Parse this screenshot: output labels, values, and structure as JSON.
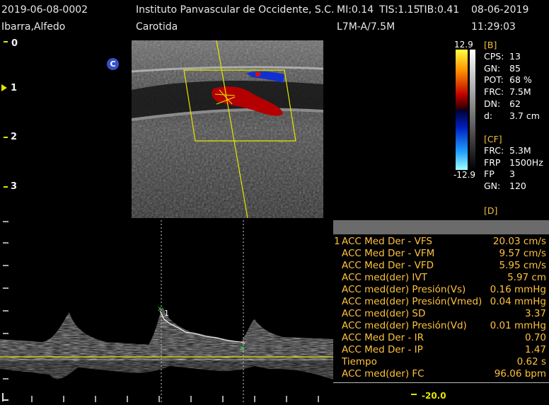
{
  "header": {
    "study_id": "2019-06-08-0002",
    "institution": "Instituto Panvascular de Occidente, S.C.",
    "mi": "MI:0.14",
    "tis": "TIS:1.15",
    "tib": "TIB:0.41",
    "date": "08-06-2019",
    "patient": "Ibarra,Alfedo",
    "exam": "Carotida",
    "probe": "L7M-A/7.5M",
    "time": "11:29:03"
  },
  "depth_scale": [
    "0",
    "1",
    "2",
    "3"
  ],
  "marker_label": "C",
  "colorbar": {
    "max": "12.9",
    "min": "-12.9"
  },
  "params": {
    "b_title": "[B]",
    "b": [
      {
        "k": "CPS:",
        "v": "13"
      },
      {
        "k": "GN:",
        "v": "85"
      },
      {
        "k": "POT:",
        "v": "68 %"
      },
      {
        "k": "FRC:",
        "v": "7.5M"
      },
      {
        "k": "DN:",
        "v": "62"
      },
      {
        "k": "d:",
        "v": "3.7 cm"
      }
    ],
    "cf_title": "[CF]",
    "cf": [
      {
        "k": "FRC:",
        "v": "5.3M"
      },
      {
        "k": "FRP",
        "v": "1500Hz"
      },
      {
        "k": "FP",
        "v": "3"
      },
      {
        "k": "GN:",
        "v": "120"
      }
    ],
    "d_title": "[D]"
  },
  "cursor_label": "1",
  "measurements": {
    "index": "1",
    "rows": [
      {
        "label": "ACC Med Der - VFS",
        "value": "20.03 cm/s"
      },
      {
        "label": "ACC Med Der - VFM",
        "value": "9.57 cm/s"
      },
      {
        "label": "ACC Med Der - VFD",
        "value": "5.95 cm/s"
      },
      {
        "label": "ACC med(der) IVT",
        "value": "5.97 cm"
      },
      {
        "label": "ACC med(der) Presión(Vs)",
        "value": "0.16 mmHg"
      },
      {
        "label": "ACC med(der) Presión(Vmed)",
        "value": "0.04 mmHg"
      },
      {
        "label": "ACC med(der) SD",
        "value": "3.37"
      },
      {
        "label": "ACC med(der) Presión(Vd)",
        "value": "0.01 mmHg"
      },
      {
        "label": "ACC Med Der - IR",
        "value": "0.70"
      },
      {
        "label": "ACC Med Der - IP",
        "value": "1.47"
      },
      {
        "label": "Tiempo",
        "value": "0.62 s"
      },
      {
        "label": "ACC med(der) FC",
        "value": "96.06 bpm"
      }
    ]
  },
  "velocity_scale": "-20.0",
  "colors": {
    "scale_yellow": "#e6e600",
    "measure_text": "#ffc23a",
    "param_section": "#f0c040",
    "flow_red": "#b40000",
    "flow_blue": "#1030d0"
  }
}
